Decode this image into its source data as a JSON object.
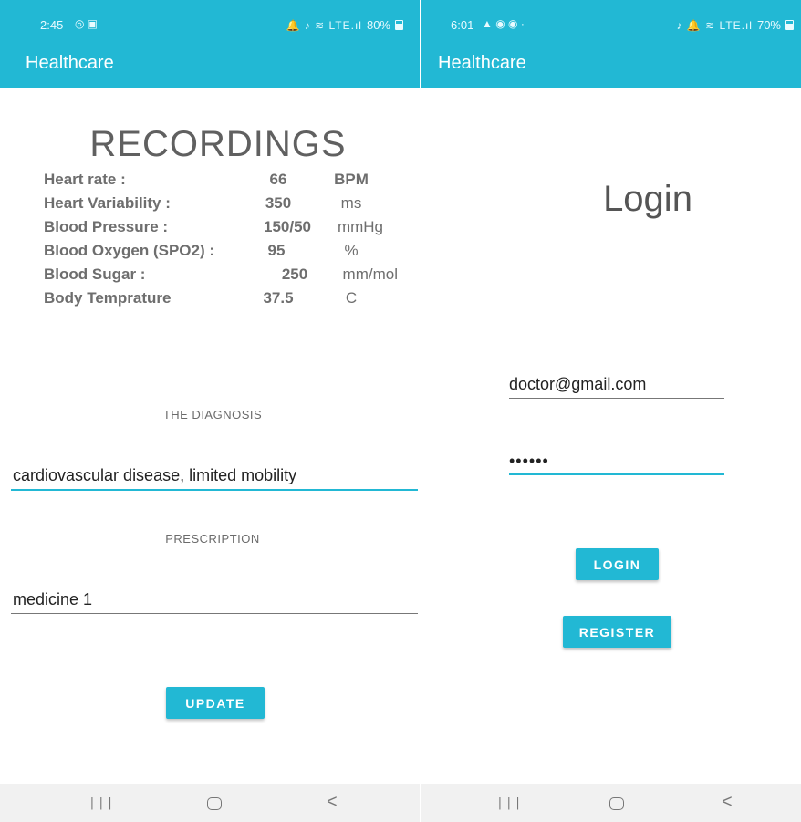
{
  "left": {
    "status_time": "2:45",
    "status_icons": "🔔 ♪ ≋ LTE.ıl",
    "status_battery": "80%",
    "app_title": "Healthcare",
    "recordings_title": "RECORDINGS",
    "recordings": [
      {
        "label": "Heart rate :",
        "value": "66",
        "unit": "BPM"
      },
      {
        "label": "Heart Variability :",
        "value": "350",
        "unit": "ms"
      },
      {
        "label": "Blood Pressure :",
        "value": "150/50",
        "unit": "mmHg"
      },
      {
        "label": "Blood Oxygen (SPO2) :",
        "value": "95",
        "unit": "%"
      },
      {
        "label": "Blood Sugar :",
        "value": "250",
        "unit": "mm/mol"
      },
      {
        "label": "Body Temprature",
        "value": "37.5",
        "unit": "C"
      }
    ],
    "diagnosis_label": "THE DIAGNOSIS",
    "diagnosis_value": "cardiovascular disease, limited mobility",
    "prescription_label": "PRESCRIPTION",
    "prescription_value": "medicine 1",
    "update_label": "UPDATE"
  },
  "right": {
    "status_time": "6:01",
    "status_icons": "♪ 🔔 ≋ LTE.ıl",
    "status_battery": "70%",
    "app_title": "Healthcare",
    "login_title": "Login",
    "email_value": "doctor@gmail.com",
    "password_value": "••••••",
    "login_label": "LOGIN",
    "register_label": "REGISTER"
  },
  "navbar": {
    "recent_glyph": "|||",
    "back_glyph": "<"
  },
  "colors": {
    "accent": "#22b8d4",
    "navbar": "#f1f1f1",
    "text_gray": "#6e6e6e"
  }
}
